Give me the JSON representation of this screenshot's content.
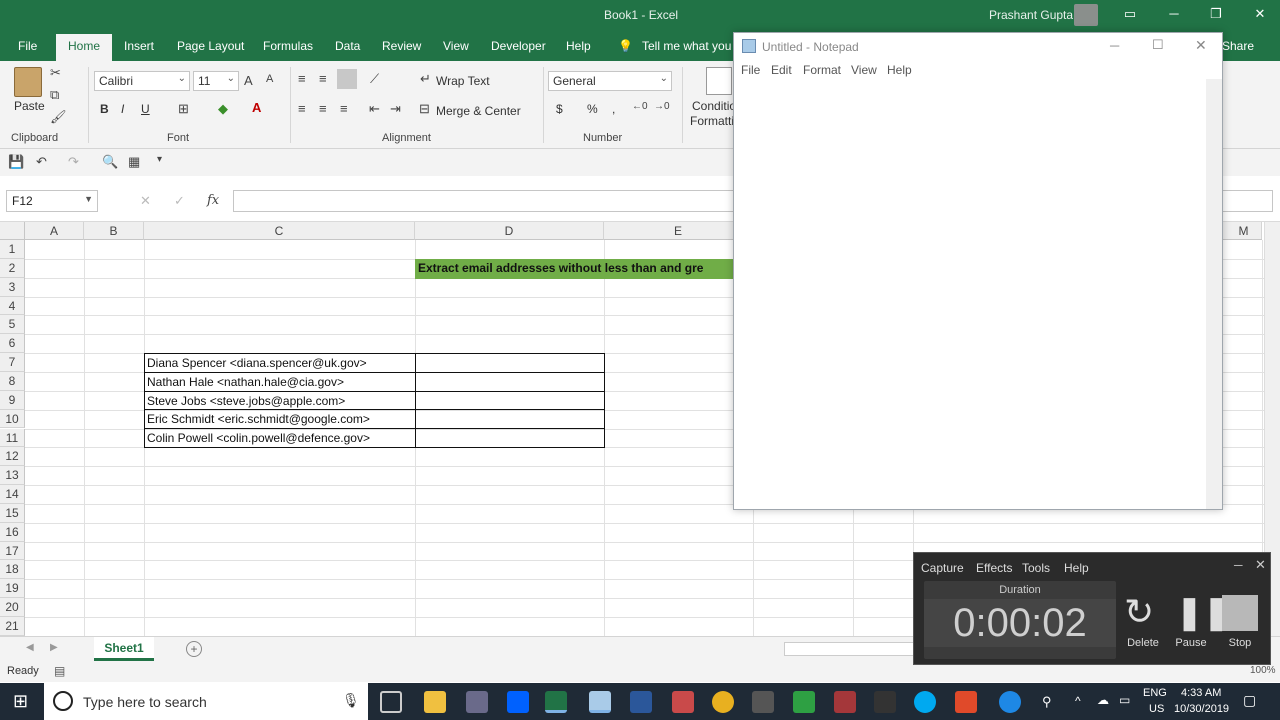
{
  "excel": {
    "title": "Book1  -  Excel",
    "user": "Prashant Gupta",
    "window_controls": [
      "▭",
      "─",
      "❐",
      "✕"
    ],
    "tabs": [
      "File",
      "Home",
      "Insert",
      "Page Layout",
      "Formulas",
      "Data",
      "Review",
      "View",
      "Developer",
      "Help"
    ],
    "tell_me": "Tell me what you w",
    "share": "Share",
    "ribbon": {
      "paste": "Paste",
      "clipboard": "Clipboard",
      "font_name": "Calibri",
      "font_size": "11",
      "font_group": "Font",
      "bold": "B",
      "italic": "I",
      "underline": "U",
      "wrap_text": "Wrap Text",
      "merge_center": "Merge & Center",
      "alignment_group": "Alignment",
      "number_format": "General",
      "number_group": "Number",
      "dollar": "$",
      "percent": "%",
      "comma": ",",
      "conditional": "Conditio",
      "formatting": "Formatti"
    },
    "formula_bar": {
      "name_box": "F12",
      "fx": "fx",
      "cancel": "✕",
      "enter": "✓",
      "content": ""
    },
    "columns": [
      "A",
      "B",
      "C",
      "D",
      "E",
      "M"
    ],
    "rows": [
      "1",
      "2",
      "3",
      "4",
      "5",
      "6",
      "7",
      "8",
      "9",
      "10",
      "11",
      "12",
      "13",
      "14",
      "15",
      "16",
      "17",
      "18",
      "19",
      "20",
      "21"
    ],
    "cells": {
      "D2": "Extract email addresses without less than and gre",
      "C7": "Diana Spencer <diana.spencer@uk.gov>",
      "C8": "Nathan Hale <nathan.hale@cia.gov>",
      "C9": "Steve Jobs <steve.jobs@apple.com>",
      "C10": "Eric Schmidt <eric.schmidt@google.com>",
      "C11": "Colin Powell <colin.powell@defence.gov>"
    },
    "header_fill": "#70ad47",
    "sheet_tab": "Sheet1",
    "add_sheet": "+",
    "status": "Ready",
    "zoom": "100%"
  },
  "notepad": {
    "title": "Untitled - Notepad",
    "menu": [
      "File",
      "Edit",
      "Format",
      "View",
      "Help"
    ],
    "controls": [
      "─",
      "☐",
      "✕"
    ],
    "content": ""
  },
  "recorder": {
    "menu": [
      "Capture",
      "Effects",
      "Tools",
      "Help"
    ],
    "duration_label": "Duration",
    "time": "0:00:02",
    "buttons": [
      "Delete",
      "Pause",
      "Stop"
    ],
    "controls": [
      "─",
      "✕"
    ]
  },
  "taskbar": {
    "search_placeholder": "Type here to search",
    "language_1": "ENG",
    "language_2": "US",
    "time": "4:33 AM",
    "date": "10/30/2019"
  }
}
